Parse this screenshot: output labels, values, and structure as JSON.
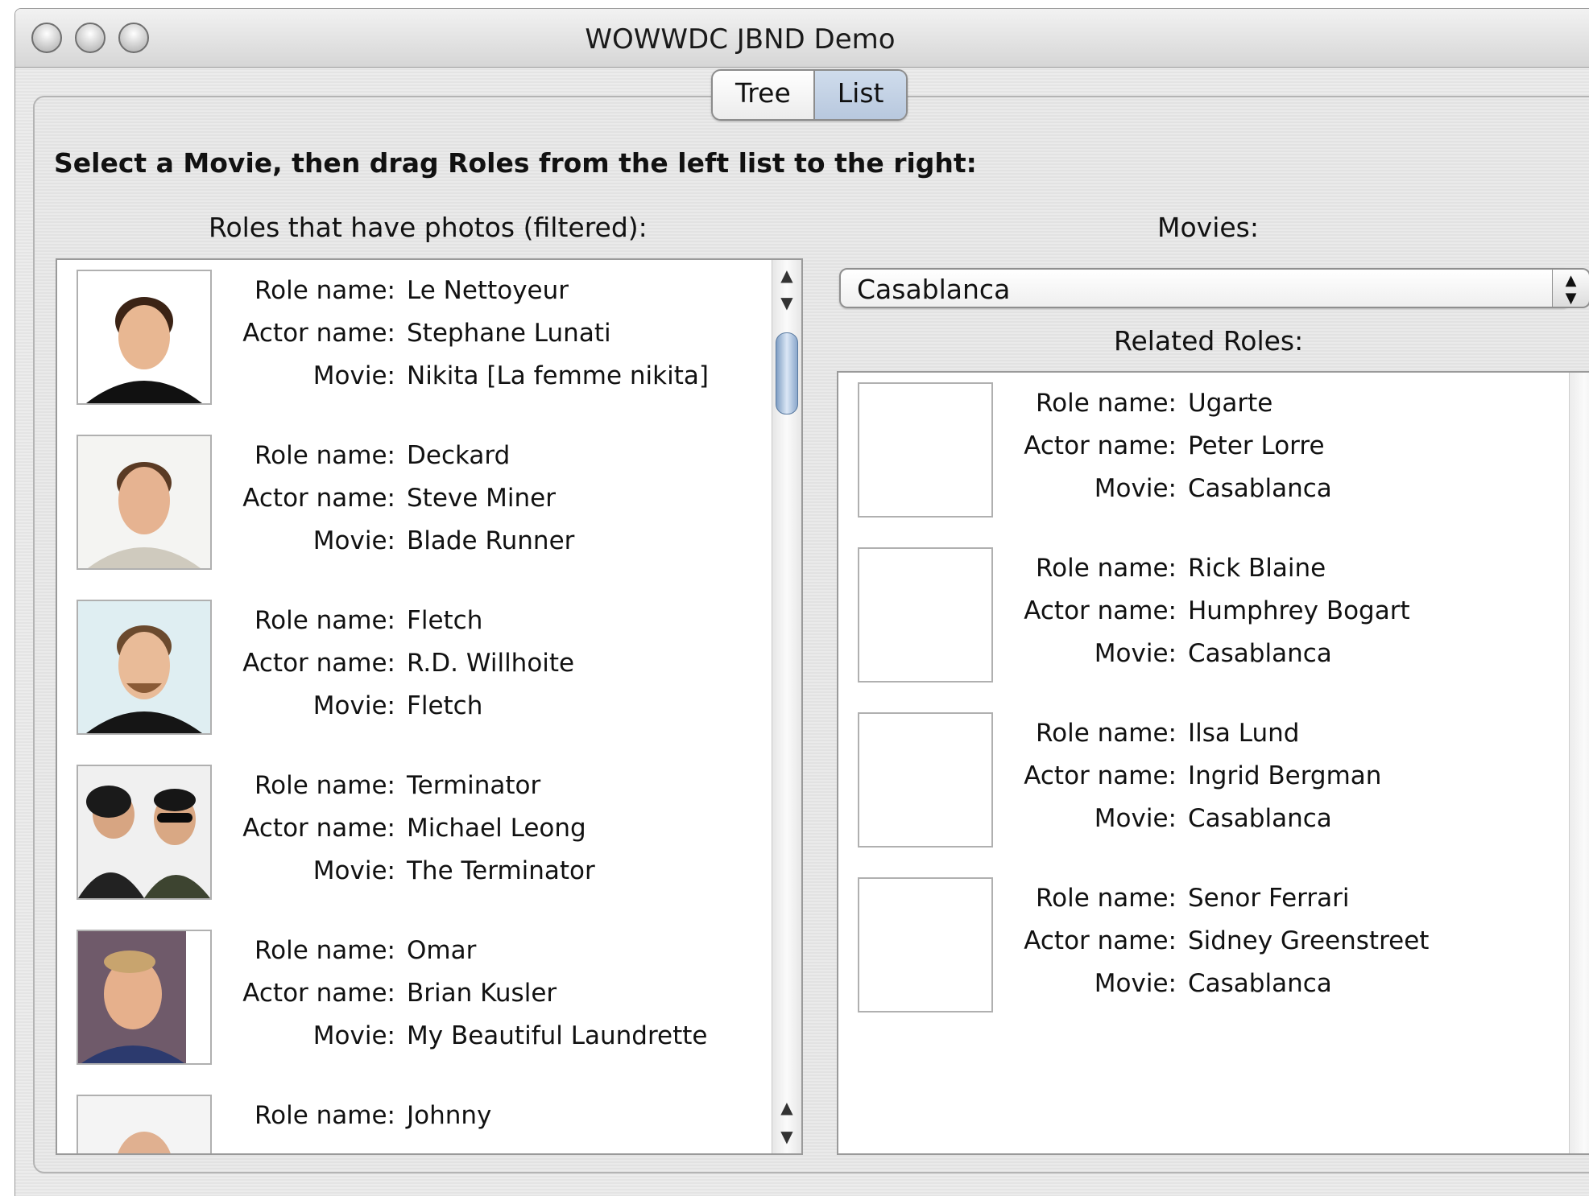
{
  "window": {
    "title": "WOWWDC JBND Demo"
  },
  "tabs": [
    {
      "label": "Tree",
      "selected": false
    },
    {
      "label": "List",
      "selected": true
    }
  ],
  "instruction": "Select a Movie, then drag Roles from the left list to the right:",
  "left_panel": {
    "header": "Roles that have photos (filtered):",
    "items": [
      {
        "role_label": "Role name:",
        "role": "Le Nettoyeur",
        "actor_label": "Actor name:",
        "actor": "Stephane Lunati",
        "movie_label": "Movie:",
        "movie": "Nikita [La femme nikita]",
        "photo": "portrait-photo"
      },
      {
        "role_label": "Role name:",
        "role": "Deckard",
        "actor_label": "Actor name:",
        "actor": "Steve Miner",
        "movie_label": "Movie:",
        "movie": "Blade Runner",
        "photo": "portrait-photo"
      },
      {
        "role_label": "Role name:",
        "role": "Fletch",
        "actor_label": "Actor name:",
        "actor": "R.D. Willhoite",
        "movie_label": "Movie:",
        "movie": "Fletch",
        "photo": "portrait-photo"
      },
      {
        "role_label": "Role name:",
        "role": "Terminator",
        "actor_label": "Actor name:",
        "actor": "Michael Leong",
        "movie_label": "Movie:",
        "movie": "The Terminator",
        "photo": "portrait-photo"
      },
      {
        "role_label": "Role name:",
        "role": "Omar",
        "actor_label": "Actor name:",
        "actor": "Brian Kusler",
        "movie_label": "Movie:",
        "movie": "My Beautiful Laundrette",
        "photo": "portrait-photo"
      },
      {
        "role_label": "Role name:",
        "role": "Johnny",
        "actor_label": "",
        "actor": "",
        "movie_label": "",
        "movie": "",
        "photo": "portrait-photo"
      }
    ]
  },
  "movies": {
    "header": "Movies:",
    "selected": "Casablanca"
  },
  "related_roles": {
    "header": "Related Roles:",
    "items": [
      {
        "role_label": "Role name:",
        "role": "Ugarte",
        "actor_label": "Actor name:",
        "actor": "Peter Lorre",
        "movie_label": "Movie:",
        "movie": "Casablanca"
      },
      {
        "role_label": "Role name:",
        "role": "Rick Blaine",
        "actor_label": "Actor name:",
        "actor": "Humphrey Bogart",
        "movie_label": "Movie:",
        "movie": "Casablanca"
      },
      {
        "role_label": "Role name:",
        "role": "Ilsa Lund",
        "actor_label": "Actor name:",
        "actor": "Ingrid Bergman",
        "movie_label": "Movie:",
        "movie": "Casablanca"
      },
      {
        "role_label": "Role name:",
        "role": "Senor Ferrari",
        "actor_label": "Actor name:",
        "actor": "Sidney Greenstreet",
        "movie_label": "Movie:",
        "movie": "Casablanca"
      }
    ]
  },
  "icons": {
    "scroll_up": "scroll-up-arrow-icon",
    "scroll_down": "scroll-down-arrow-icon",
    "popup_arrows": "updown-arrows-icon"
  },
  "colors": {
    "scroll_thumb": "#7f9ec3",
    "selected_tab": "#c4d3e6"
  }
}
